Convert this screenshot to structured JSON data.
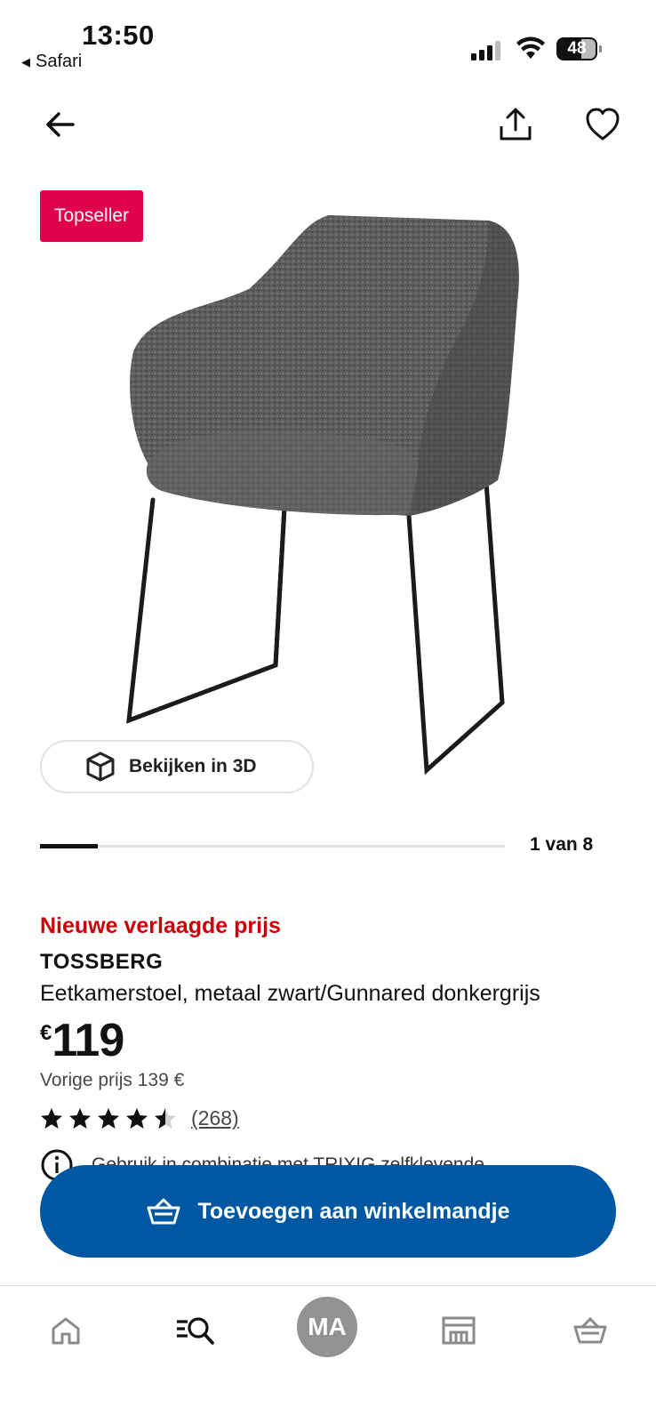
{
  "status_bar": {
    "time": "13:50",
    "back_app": "Safari",
    "battery": "48"
  },
  "icons": {
    "back": "arrow-left-icon",
    "share": "share-icon",
    "favourite": "heart-icon",
    "view3d": "cube-icon",
    "info": "info-icon",
    "cart": "basket-icon",
    "tabs": [
      "home-icon",
      "search-products-icon",
      "profile-avatar",
      "store-icon",
      "basket-icon"
    ]
  },
  "product": {
    "badge": "Topseller",
    "view3d_label": "Bekijken in 3D",
    "pager_label": "1 van 8",
    "pager_progress": 0.125,
    "promo": "Nieuwe verlaagde prijs",
    "name": "TOSSBERG",
    "description": "Eetkamerstoel, metaal zwart/Gunnared donkergrijs",
    "currency": "€",
    "price": "119",
    "previous_price": "Vorige prijs 139 €",
    "rating": 4.5,
    "rating_max": 5,
    "review_count": "(268)",
    "note": "Gebruik in combinatie met TRIXIG zelfklevende"
  },
  "cta": {
    "label": "Toevoegen aan winkelmandje"
  },
  "tabbar": {
    "avatar_initials": "MA"
  },
  "colors": {
    "badge": "#e0004d",
    "promo": "#cc0008",
    "cta": "#0058a3"
  }
}
